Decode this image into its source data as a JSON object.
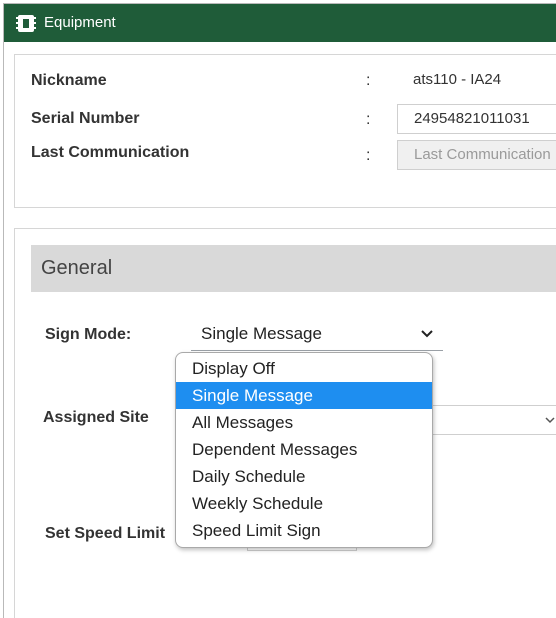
{
  "window": {
    "title": "Equipment",
    "icon": "equipment-icon"
  },
  "info": {
    "rows": [
      {
        "label": "Nickname",
        "colon": ":",
        "value": "ats110 - IA24"
      },
      {
        "label": "Serial Number",
        "colon": ":",
        "value": "24954821011031"
      },
      {
        "label": "Last Communication",
        "colon": ":",
        "value": "Last Communication"
      }
    ]
  },
  "general": {
    "header": "General",
    "sign_mode_label": "Sign Mode:",
    "sign_mode_value": "Single Message",
    "assigned_label": "Assigned Site",
    "speed_label": "Set Speed Limit"
  },
  "dropdown": {
    "options": [
      "Display Off",
      "Single Message",
      "All Messages",
      "Dependent Messages",
      "Daily Schedule",
      "Weekly Schedule",
      "Speed Limit Sign"
    ],
    "selected": "Single Message"
  },
  "colors": {
    "titlebar": "#1f5c39",
    "selected_option": "#1e8ef0",
    "section_header": "#d9d9d9"
  }
}
